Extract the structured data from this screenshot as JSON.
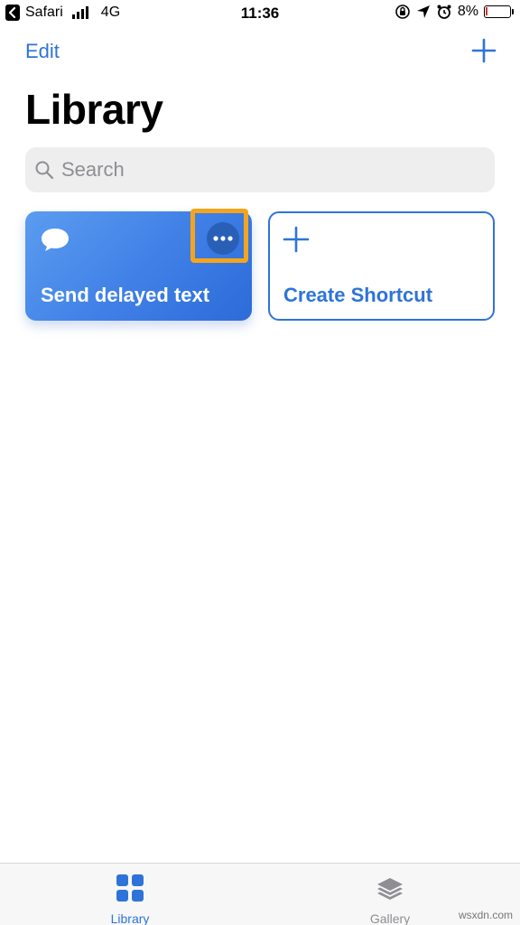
{
  "status_bar": {
    "back_app": "Safari",
    "network": "4G",
    "time": "11:36",
    "battery_percent": "8%",
    "battery_level": 0.08
  },
  "nav": {
    "edit_label": "Edit",
    "add_icon": "plus-icon"
  },
  "page": {
    "title": "Library"
  },
  "search": {
    "placeholder": "Search",
    "icon": "search-icon"
  },
  "shortcuts": [
    {
      "title": "Send delayed text",
      "icon": "message-bubble-icon",
      "more_icon": "ellipsis-icon",
      "highlighted": true
    }
  ],
  "create_card": {
    "title": "Create Shortcut",
    "icon": "plus-icon"
  },
  "tabs": [
    {
      "label": "Library",
      "icon": "grid-icon",
      "active": true
    },
    {
      "label": "Gallery",
      "icon": "layers-icon",
      "active": false
    }
  ],
  "colors": {
    "accent": "#2e74d8",
    "card_gradient_start": "#5b9cf0",
    "card_gradient_end": "#2c6bd9",
    "highlight": "#f4a51c",
    "battery_low": "#e0302b"
  },
  "watermark": "wsxdn.com"
}
